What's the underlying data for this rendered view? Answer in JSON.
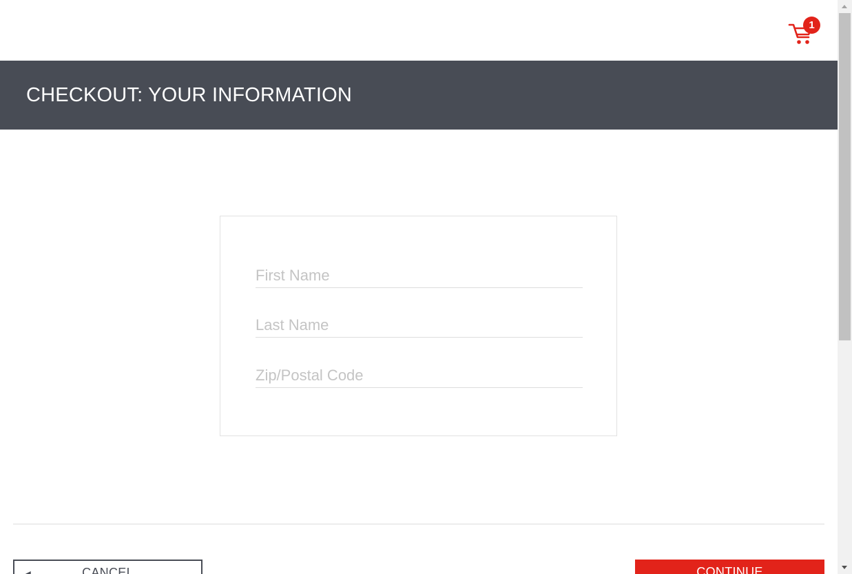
{
  "header": {
    "cart_count": "1"
  },
  "title_bar": {
    "title": "CHECKOUT: YOUR INFORMATION"
  },
  "form": {
    "first_name": {
      "placeholder": "First Name",
      "value": ""
    },
    "last_name": {
      "placeholder": "Last Name",
      "value": ""
    },
    "postal_code": {
      "placeholder": "Zip/Postal Code",
      "value": ""
    }
  },
  "footer": {
    "cancel_label": "CANCEL",
    "continue_label": "CONTINUE"
  },
  "icons": {
    "cart": "shopping-cart-icon",
    "back": "arrow-left-icon"
  },
  "colors": {
    "accent": "#e2231a",
    "header_bg": "#484c55",
    "placeholder": "#c4c4c4",
    "border": "#e1e1e1"
  }
}
